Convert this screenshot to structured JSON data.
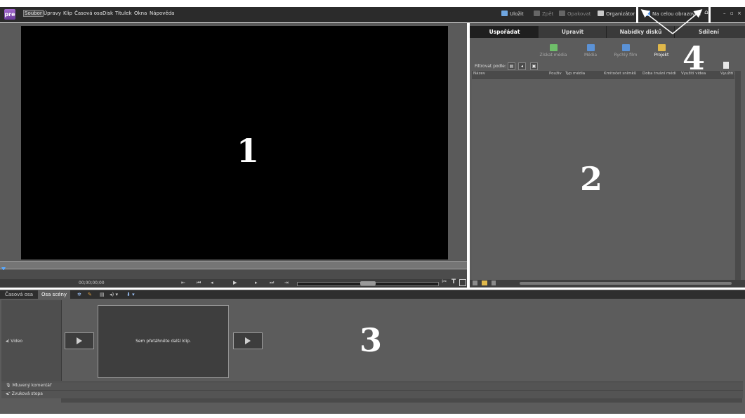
{
  "app": {
    "logo": "pre"
  },
  "menu": [
    "Soubor",
    "Úpravy",
    "Klip",
    "Časová osa",
    "Disk",
    "Titulek",
    "Okna",
    "Nápověda"
  ],
  "toolbar": {
    "save": "Uložit",
    "undo": "Zpět",
    "redo": "Opakovat",
    "organizer": "Organizátor",
    "fullscreen": "Na celou obrazovku"
  },
  "monitor": {
    "timecode": "00;00;00;00"
  },
  "panel": {
    "tabs": [
      "Uspořádat",
      "Upravit",
      "Nabídky disků",
      "Sdílení"
    ],
    "tools": [
      "Získat média",
      "Média",
      "Rychlý film",
      "Projekt"
    ],
    "filter_label": "Filtrovat podle:",
    "columns": [
      "Název",
      "Použiv",
      "Typ média",
      "Kmitočet snímků",
      "Doba trvání médi",
      "Využití videa",
      "Využití z"
    ]
  },
  "timeline": {
    "tabs": [
      "Časová osa",
      "Osa scény"
    ],
    "video_label": "Video",
    "drop_text": "Sem přetáhněte další klip.",
    "narration_label": "Mluvený komentář",
    "soundtrack_label": "Zvuková stopa"
  },
  "annotations": [
    "1",
    "2",
    "3",
    "4"
  ],
  "colors": {
    "accent": "#56a7ff",
    "bg_dark": "#2b2b2b",
    "panel": "#5c5c5c"
  }
}
